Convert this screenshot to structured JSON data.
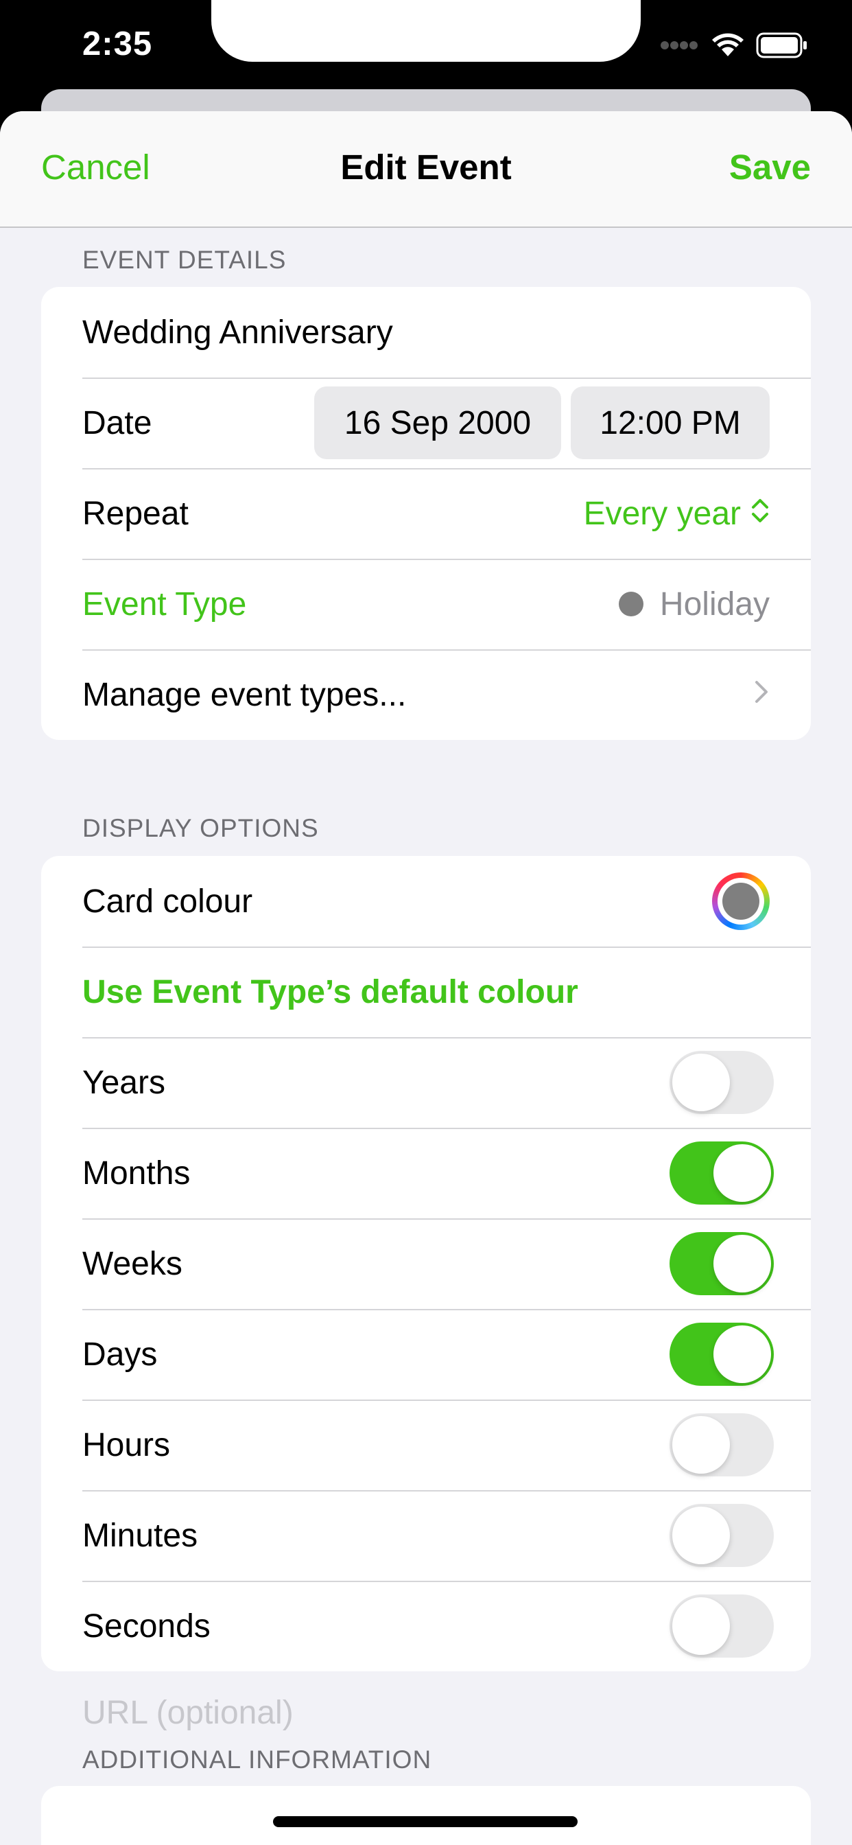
{
  "status": {
    "time": "2:35"
  },
  "nav": {
    "cancel": "Cancel",
    "title": "Edit Event",
    "save": "Save"
  },
  "event_details": {
    "header": "EVENT DETAILS",
    "name": "Wedding Anniversary",
    "date_label": "Date",
    "date_value": "16 Sep 2000",
    "time_value": "12:00 PM",
    "repeat_label": "Repeat",
    "repeat_value": "Every year",
    "event_type_label": "Event Type",
    "event_type_value": "Holiday",
    "manage_label": "Manage event types..."
  },
  "display_options": {
    "header": "DISPLAY OPTIONS",
    "card_colour_label": "Card colour",
    "default_colour_label": "Use Event Type’s default colour",
    "toggles": [
      {
        "label": "Years",
        "on": false
      },
      {
        "label": "Months",
        "on": true
      },
      {
        "label": "Weeks",
        "on": true
      },
      {
        "label": "Days",
        "on": true
      },
      {
        "label": "Hours",
        "on": false
      },
      {
        "label": "Minutes",
        "on": false
      },
      {
        "label": "Seconds",
        "on": false
      }
    ]
  },
  "additional_info": {
    "header": "ADDITIONAL INFORMATION",
    "url_placeholder": "URL (optional)"
  },
  "colors": {
    "accent": "#42c41a",
    "event_type_dot": "#7f7f7f",
    "background": "#f2f2f7"
  },
  "icons": {
    "repeat": "chevron-up-down-icon",
    "manage": "chevron-right-icon"
  }
}
